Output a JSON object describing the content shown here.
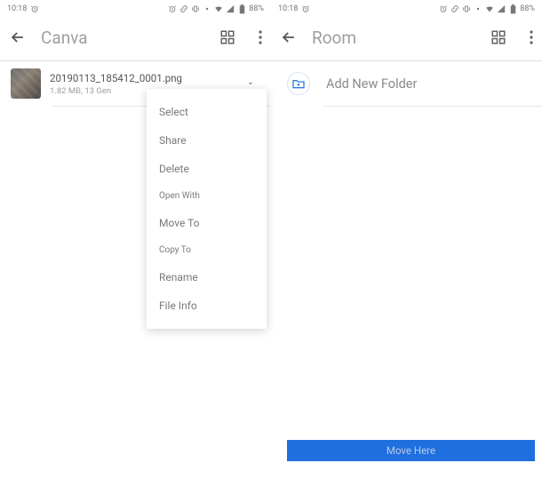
{
  "statusbar": {
    "time": "10:18",
    "battery": "88%"
  },
  "left": {
    "title": "Canva",
    "file": {
      "name": "20190113_185412_0001.png",
      "sub": "1.82 MB, 13 Gen",
      "thumb_alt": "image-thumbnail"
    },
    "menu": {
      "select": "Select",
      "share": "Share",
      "delete": "Delete",
      "open_with": "Open With",
      "move_to": "Move To",
      "copy_to": "Copy To",
      "rename": "Rename",
      "file_info": "File Info"
    }
  },
  "right": {
    "title": "Room",
    "add_folder": "Add New Folder",
    "move_button": "Move Here"
  },
  "icons": {
    "alarm": "⏰",
    "link": "🔗"
  },
  "colors": {
    "accent": "#1f6fe0"
  }
}
